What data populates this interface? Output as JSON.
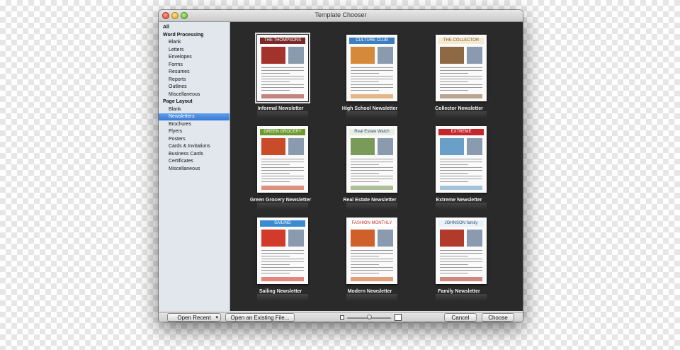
{
  "window": {
    "title": "Template Chooser"
  },
  "sidebar": {
    "items": [
      {
        "label": "All",
        "kind": "head"
      },
      {
        "label": "Word Processing",
        "kind": "head"
      },
      {
        "label": "Blank",
        "kind": "sub"
      },
      {
        "label": "Letters",
        "kind": "sub"
      },
      {
        "label": "Envelopes",
        "kind": "sub"
      },
      {
        "label": "Forms",
        "kind": "sub"
      },
      {
        "label": "Resumes",
        "kind": "sub"
      },
      {
        "label": "Reports",
        "kind": "sub"
      },
      {
        "label": "Outlines",
        "kind": "sub"
      },
      {
        "label": "Miscellaneous",
        "kind": "sub"
      },
      {
        "label": "Page Layout",
        "kind": "head"
      },
      {
        "label": "Blank",
        "kind": "sub"
      },
      {
        "label": "Newsletters",
        "kind": "sub",
        "selected": true
      },
      {
        "label": "Brochures",
        "kind": "sub"
      },
      {
        "label": "Flyers",
        "kind": "sub"
      },
      {
        "label": "Posters",
        "kind": "sub"
      },
      {
        "label": "Cards & Invitations",
        "kind": "sub"
      },
      {
        "label": "Business Cards",
        "kind": "sub"
      },
      {
        "label": "Certificates",
        "kind": "sub"
      },
      {
        "label": "Miscellaneous",
        "kind": "sub"
      }
    ]
  },
  "templates": [
    {
      "label": "Informal Newsletter",
      "masthead": "THE THOMPSONS",
      "mast_color": "#7b2a2a",
      "mast_text": "#ffffff",
      "accent": "#a3322c",
      "selected": true
    },
    {
      "label": "High School Newsletter",
      "masthead": "CULTURE CLUB",
      "mast_color": "#3d7fbf",
      "mast_text": "#ffffff",
      "accent": "#d58a3a"
    },
    {
      "label": "Collector Newsletter",
      "masthead": "THE COLLECTOR",
      "mast_color": "#f3ead2",
      "mast_text": "#8a5a2a",
      "accent": "#8d6a44"
    },
    {
      "label": "Green Grocery Newsletter",
      "masthead": "GREEN GROCERY",
      "mast_color": "#6f9a2f",
      "mast_text": "#ffffff",
      "accent": "#c84b2a"
    },
    {
      "label": "Real Estate Newsletter",
      "masthead": "Real Estate Watch",
      "mast_color": "#e9efe3",
      "mast_text": "#2b4f7a",
      "accent": "#7a9a5a"
    },
    {
      "label": "Extreme Newsletter",
      "masthead": "EXTREME",
      "mast_color": "#c6262a",
      "mast_text": "#ffffff",
      "accent": "#6aa0c8"
    },
    {
      "label": "Sailing Newsletter",
      "masthead": "SAILING",
      "mast_color": "#3a8bd0",
      "mast_text": "#ffffff",
      "accent": "#d23a2a"
    },
    {
      "label": "Modern Newsletter",
      "masthead": "FASHION MONTHLY",
      "mast_color": "#ffffff",
      "mast_text": "#c9302c",
      "accent": "#d0602a"
    },
    {
      "label": "Family Newsletter",
      "masthead": "JOHNSON family",
      "mast_color": "#eaf2f7",
      "mast_text": "#2a4e78",
      "accent": "#b23a2a"
    }
  ],
  "footer": {
    "open_recent": "Open Recent",
    "open_existing": "Open an Existing File...",
    "cancel": "Cancel",
    "choose": "Choose",
    "thumbnail_size_percent": 50
  },
  "icons": {
    "recent_arrow": "chevron-down-icon",
    "size_small": "small-thumbnail-icon",
    "size_large": "large-thumbnail-icon"
  }
}
